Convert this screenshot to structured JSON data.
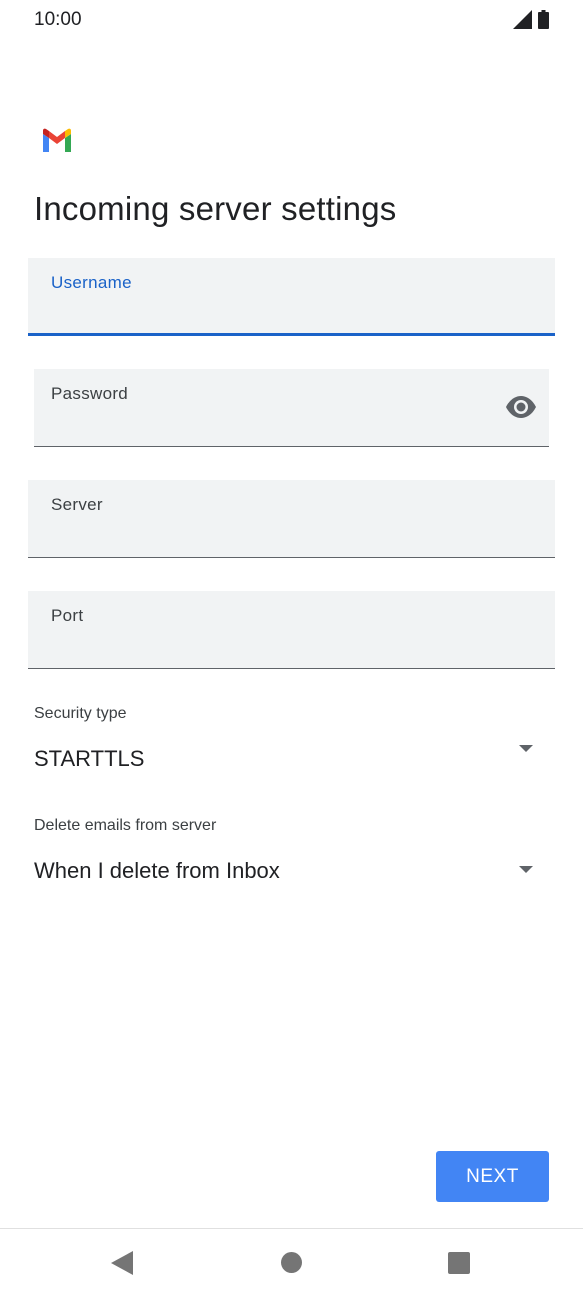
{
  "status_bar": {
    "time": "10:00",
    "icons": [
      "signal-icon",
      "battery-icon"
    ]
  },
  "app": {
    "logo": "gmail-logo",
    "title": "Incoming server settings"
  },
  "form": {
    "username": {
      "label": "Username",
      "value": "",
      "focused": true
    },
    "password": {
      "label": "Password",
      "value": "",
      "toggle_icon": "eye-icon"
    },
    "server": {
      "label": "Server",
      "value": ""
    },
    "port": {
      "label": "Port",
      "value": ""
    },
    "security_type": {
      "label": "Security type",
      "value": "STARTTLS",
      "icon": "dropdown-arrow-icon"
    },
    "delete_emails": {
      "label": "Delete emails from server",
      "value": "When I delete from Inbox",
      "icon": "dropdown-arrow-icon"
    }
  },
  "actions": {
    "next_label": "NEXT"
  },
  "nav_bar": {
    "buttons": [
      "back-icon",
      "home-icon",
      "recents-icon"
    ]
  },
  "colors": {
    "accent": "#1a62c8",
    "button": "#4285f4",
    "field_bg": "#f1f3f4"
  }
}
